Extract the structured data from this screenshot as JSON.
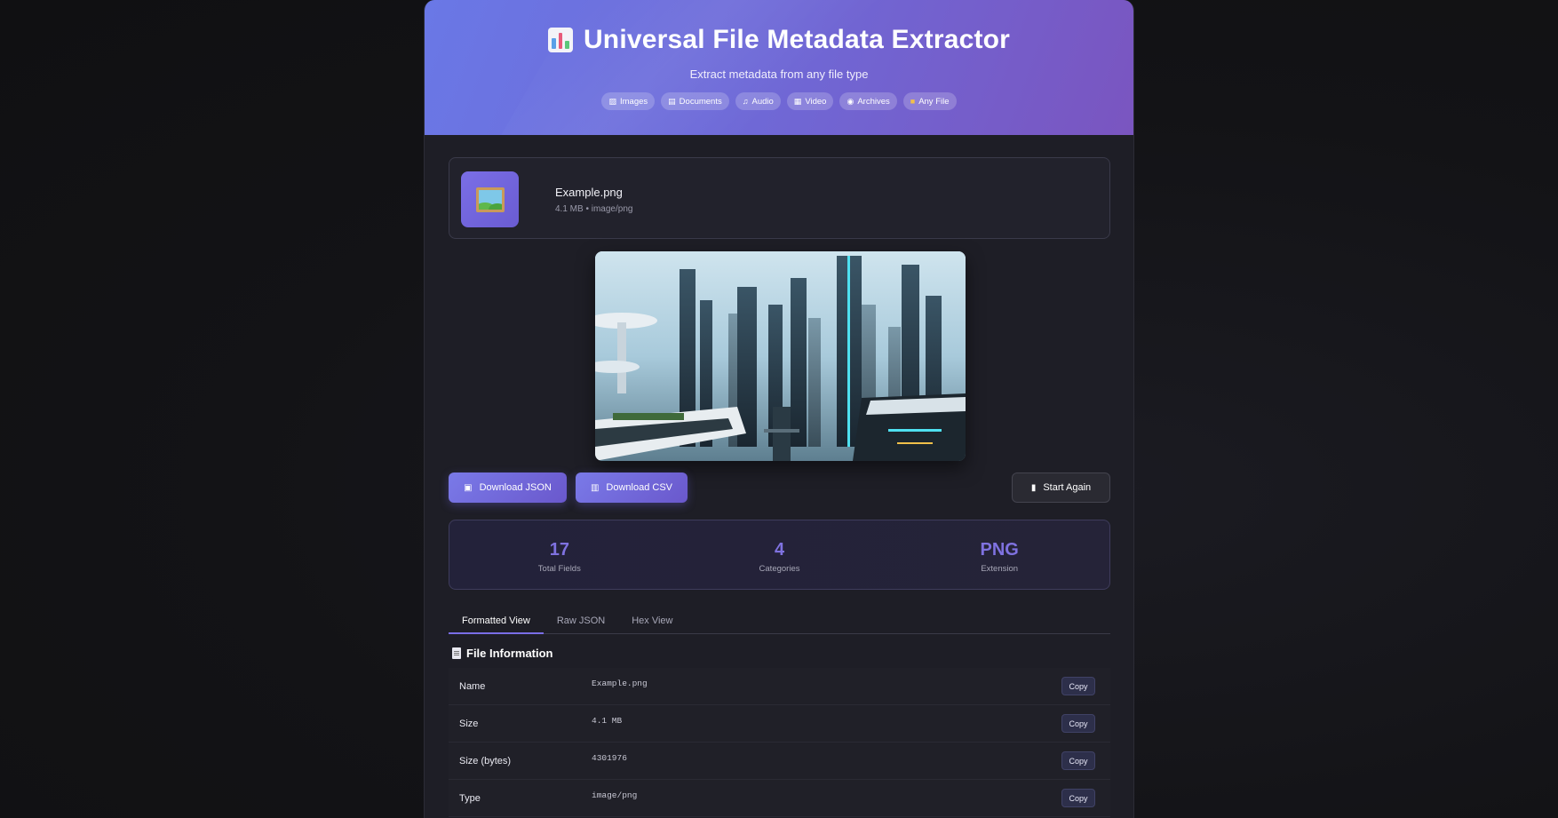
{
  "header": {
    "title": "Universal File Metadata Extractor",
    "subtitle": "Extract metadata from any file type",
    "title_icon": "bar-chart-icon",
    "pills": [
      {
        "icon": "image-icon",
        "label": "Images"
      },
      {
        "icon": "document-icon",
        "label": "Documents"
      },
      {
        "icon": "music-icon",
        "label": "Audio"
      },
      {
        "icon": "film-icon",
        "label": "Video"
      },
      {
        "icon": "archive-icon",
        "label": "Archives"
      },
      {
        "icon": "folder-icon",
        "label": "Any File"
      }
    ]
  },
  "file": {
    "name": "Example.png",
    "meta": "4.1 MB • image/png",
    "icon": "picture-icon"
  },
  "actions": {
    "download_json": "Download JSON",
    "download_csv": "Download CSV",
    "start_again": "Start Again"
  },
  "stats": [
    {
      "value": "17",
      "label": "Total Fields"
    },
    {
      "value": "4",
      "label": "Categories"
    },
    {
      "value": "PNG",
      "label": "Extension"
    }
  ],
  "tabs": [
    {
      "label": "Formatted View",
      "active": true
    },
    {
      "label": "Raw JSON",
      "active": false
    },
    {
      "label": "Hex View",
      "active": false
    }
  ],
  "section": {
    "title": "File Information",
    "rows": [
      {
        "key": "Name",
        "value": "Example.png",
        "copy": "Copy"
      },
      {
        "key": "Size",
        "value": "4.1 MB",
        "copy": "Copy"
      },
      {
        "key": "Size (bytes)",
        "value": "4301976",
        "copy": "Copy"
      },
      {
        "key": "Type",
        "value": "image/png",
        "copy": "Copy"
      }
    ]
  },
  "colors": {
    "accent": "#7a6ee6",
    "header_start": "#6a78e6",
    "header_end": "#7a55c0",
    "panel_bg": "#1e1e26"
  }
}
